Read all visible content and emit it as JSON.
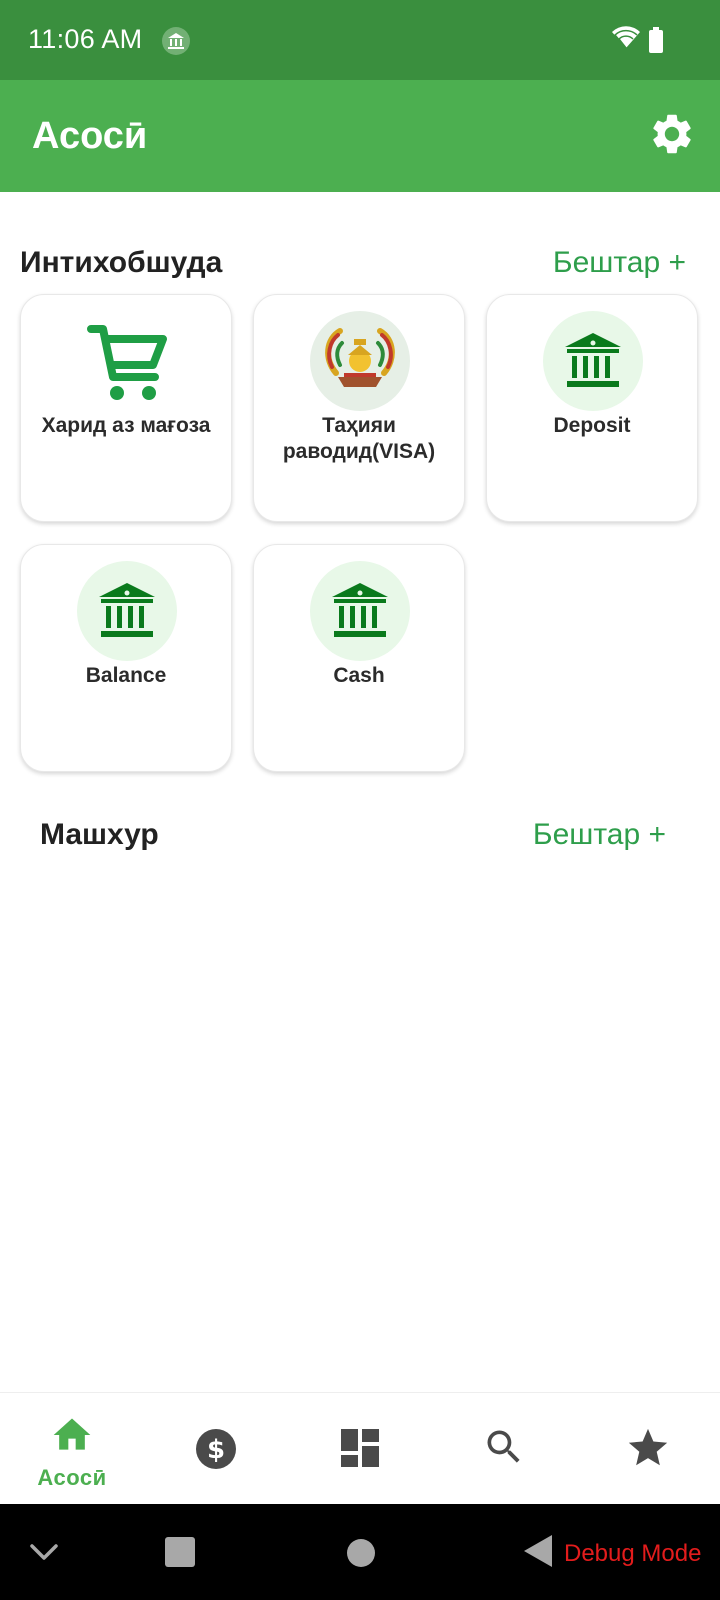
{
  "status_bar": {
    "time": "11:06 AM"
  },
  "app_bar": {
    "title": "Асосӣ",
    "settings_icon": "gear-icon"
  },
  "favorites": {
    "title": "Интихобшуда",
    "more_label": "Бештар +",
    "cards": [
      {
        "label": "Харид аз мағоза",
        "icon": "shopping-cart-icon"
      },
      {
        "label": "Таҳияи раводид(VISA)",
        "icon": "tajikistan-emblem-icon"
      },
      {
        "label": "Deposit",
        "icon": "bank-icon"
      },
      {
        "label": "Balance",
        "icon": "bank-icon"
      },
      {
        "label": "Cash",
        "icon": "bank-icon"
      }
    ]
  },
  "popular": {
    "title": "Машхур",
    "more_label": "Бештар +"
  },
  "bottom_nav": {
    "items": [
      {
        "label": "Асосӣ",
        "icon": "home-icon",
        "active": true
      },
      {
        "label": "",
        "icon": "dollar-icon",
        "active": false
      },
      {
        "label": "",
        "icon": "dashboard-icon",
        "active": false
      },
      {
        "label": "",
        "icon": "search-icon",
        "active": false
      },
      {
        "label": "",
        "icon": "star-icon",
        "active": false
      }
    ]
  },
  "system_nav": {
    "debug_label": "Debug Mode"
  },
  "colors": {
    "status_bar": "#3a8f3e",
    "app_bar": "#4caf50",
    "accent_green": "#2e9e4b",
    "icon_green": "#0a7a1c",
    "icon_bg": "#e8f8e8",
    "debug_red": "#e31c1c"
  }
}
